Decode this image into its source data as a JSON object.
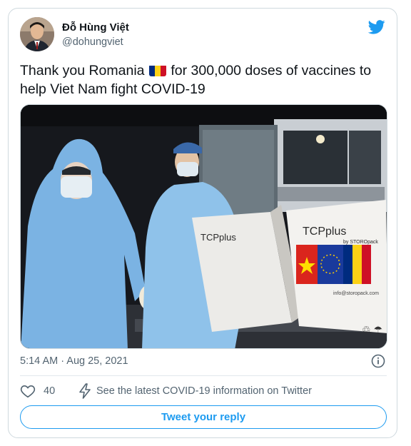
{
  "author": {
    "display_name": "Đỗ Hùng Việt",
    "handle": "@dohungviet"
  },
  "tweet": {
    "text_before_flag": "Thank you Romania ",
    "text_after_flag": " for 300,000 doses of vaccines to help Viet Nam fight COVID-19",
    "flag_emoji": "romania-flag-icon",
    "timestamp": "5:14 AM · Aug 25, 2021"
  },
  "media": {
    "box_brand": "TCPplus",
    "box_brand_sub": "by STOROpack",
    "box_url": "info@storopack.com"
  },
  "actions": {
    "like_count": "40",
    "covid_info_text": "See the latest COVID-19 information on Twitter"
  },
  "reply_button_label": "Tweet your reply",
  "colors": {
    "accent": "#1d9bf0",
    "secondary_text": "#536471",
    "border": "#cfd9de",
    "flag_blue": "#002b7f",
    "flag_yellow": "#fcd116",
    "flag_red": "#ce1126"
  },
  "icons": [
    "twitter-bird-icon",
    "info-icon",
    "heart-icon",
    "lightning-bolt-icon"
  ]
}
